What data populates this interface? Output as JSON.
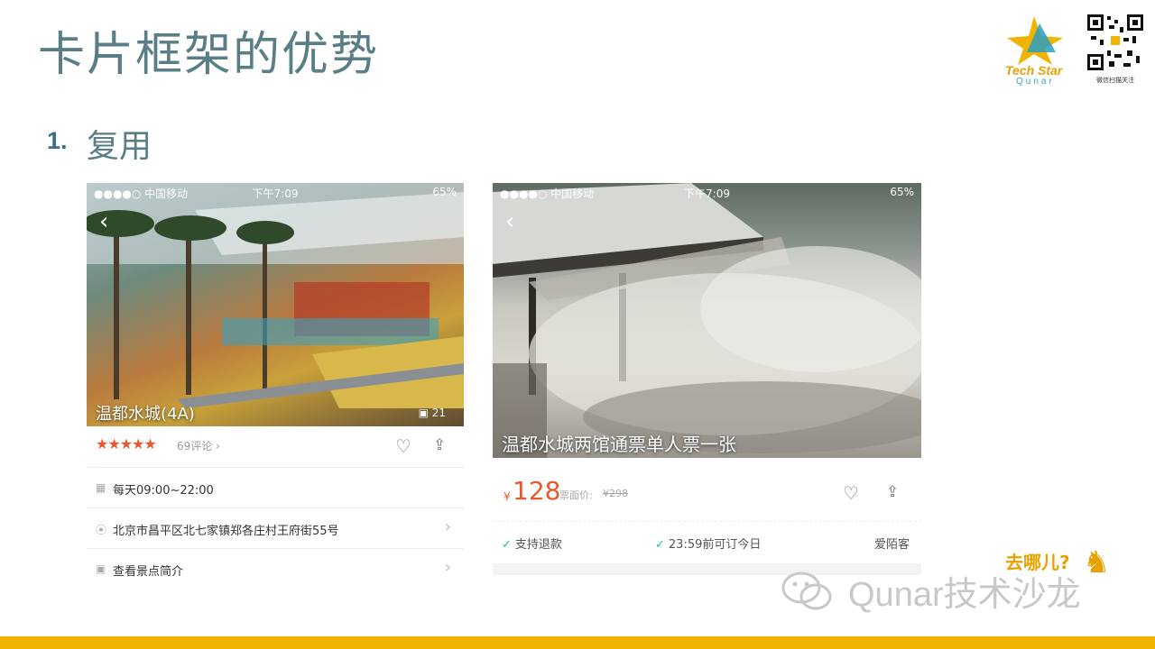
{
  "slide": {
    "title": "卡片框架的优势",
    "sub_number": "1.",
    "sub_text": "复用"
  },
  "logo": {
    "line1": "Tech Star",
    "line2": "Qunar"
  },
  "qr_caption": "微信扫描关注",
  "phone1": {
    "status": {
      "carrier": "●●●●○ 中国移动",
      "time": "下午7:09",
      "battery": "65%"
    },
    "title": "温都水城(4A)",
    "photo_count": "21",
    "rating_stars": "★★★★★",
    "reviews": "69评论",
    "hours": "每天09:00~22:00",
    "address": "北京市昌平区北七家镇郑各庄村王府街55号",
    "intro": "查看景点简介"
  },
  "phone2": {
    "status": {
      "carrier": "●●●●○ 中国移动",
      "time": "下午7:09",
      "battery": "65%"
    },
    "title": "温都水城两馆通票单人票一张",
    "price_symbol": "¥",
    "price": "128",
    "orig_label": "票面价:",
    "orig_price": "¥298",
    "feature1": "支持退款",
    "feature2": "23:59前可订今日",
    "vendor": "爱陌客"
  },
  "watermark": {
    "text": "Qunar技术沙龙",
    "brand": "去哪儿?"
  },
  "colors": {
    "accent": "#f0b400",
    "price": "#e8582d",
    "title": "#5a7e86",
    "check": "#2bb9a8"
  }
}
